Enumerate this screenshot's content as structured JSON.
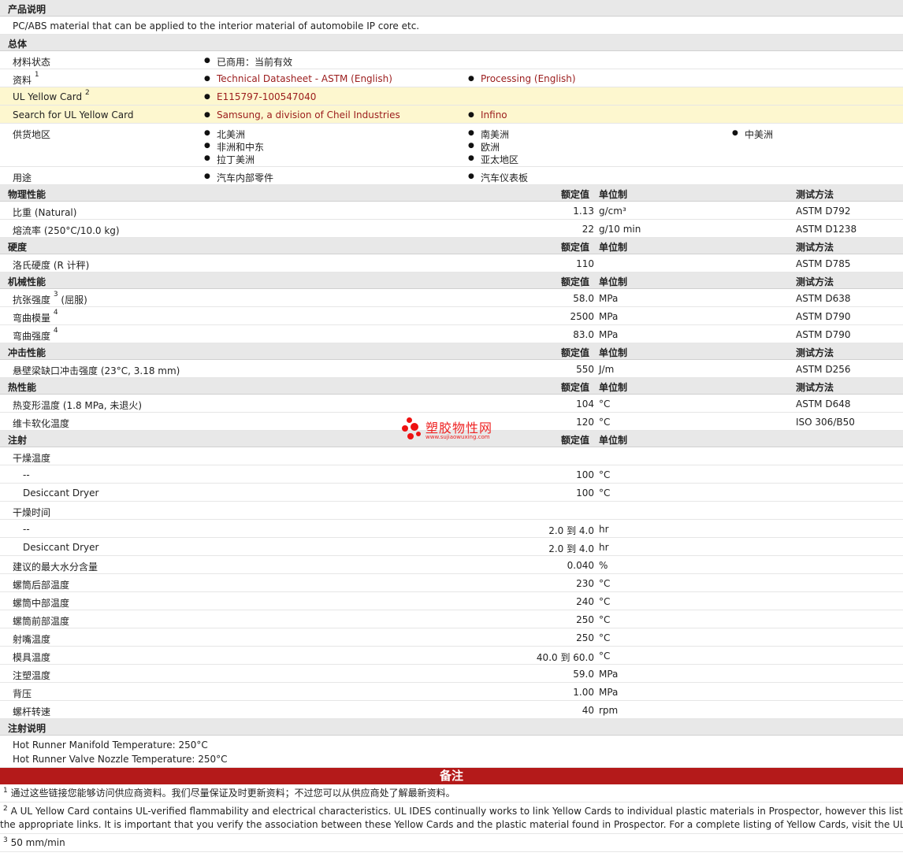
{
  "product": {
    "section": "产品说明",
    "description": "PC/ABS material that can be applied to the interior material of automobile IP core etc."
  },
  "general": {
    "section": "总体",
    "status_label": "材料状态",
    "status_value": "已商用：当前有效",
    "docs_label": "资料",
    "docs_sup": "1",
    "docs": [
      "Technical Datasheet - ASTM (English)",
      "Processing (English)"
    ],
    "ul_label": "UL Yellow Card",
    "ul_sup": "2",
    "ul_value": "E115797-100547040",
    "search_label": "Search for UL Yellow Card",
    "search_values": [
      "Samsung, a division of Cheil Industries",
      "Infino"
    ],
    "supply_label": "供货地区",
    "supply": [
      "北美洲",
      "南美洲",
      "中美洲",
      "非洲和中东",
      "欧洲",
      "拉丁美洲",
      "亚太地区"
    ],
    "use_label": "用途",
    "uses": [
      "汽车内部零件",
      "汽车仪表板"
    ]
  },
  "headers": {
    "value": "额定值",
    "unit": "单位制",
    "method": "测试方法"
  },
  "physical": {
    "section": "物理性能",
    "rows": [
      {
        "label": "比重 (Natural)",
        "sup": "",
        "value": "1.13",
        "unit": "g/cm³",
        "method": "ASTM D792"
      },
      {
        "label": "熔流率 (250°C/10.0 kg)",
        "sup": "",
        "value": "22",
        "unit": "g/10 min",
        "method": "ASTM D1238"
      }
    ]
  },
  "hardness": {
    "section": "硬度",
    "rows": [
      {
        "label": "洛氏硬度 (R 计秤)",
        "sup": "",
        "value": "110",
        "unit": "",
        "method": "ASTM D785"
      }
    ]
  },
  "mechanical": {
    "section": "机械性能",
    "rows": [
      {
        "label": "抗张强度",
        "sup": "3",
        "suffix": "(屈服)",
        "value": "58.0",
        "unit": "MPa",
        "method": "ASTM D638"
      },
      {
        "label": "弯曲模量",
        "sup": "4",
        "suffix": "",
        "value": "2500",
        "unit": "MPa",
        "method": "ASTM D790"
      },
      {
        "label": "弯曲强度",
        "sup": "4",
        "suffix": "",
        "value": "83.0",
        "unit": "MPa",
        "method": "ASTM D790"
      }
    ]
  },
  "impact": {
    "section": "冲击性能",
    "rows": [
      {
        "label": "悬壁梁缺口冲击强度 (23°C, 3.18 mm)",
        "sup": "",
        "value": "550",
        "unit": "J/m",
        "method": "ASTM D256"
      }
    ]
  },
  "thermal": {
    "section": "热性能",
    "rows": [
      {
        "label": "热变形温度 (1.8 MPa, 未退火)",
        "sup": "",
        "value": "104",
        "unit": "°C",
        "method": "ASTM D648"
      },
      {
        "label": "维卡软化温度",
        "sup": "",
        "value": "120",
        "unit": "°C",
        "method": "ISO 306/B50"
      }
    ]
  },
  "injection": {
    "section": "注射",
    "drying_temp_label": "干燥温度",
    "drying_temp": [
      {
        "label": "--",
        "value": "100",
        "unit": "°C"
      },
      {
        "label": "Desiccant Dryer",
        "value": "100",
        "unit": "°C"
      }
    ],
    "drying_time_label": "干燥时间",
    "drying_time": [
      {
        "label": "--",
        "value": "2.0 到  4.0",
        "unit": "hr"
      },
      {
        "label": "Desiccant Dryer",
        "value": "2.0 到  4.0",
        "unit": "hr"
      }
    ],
    "rows": [
      {
        "label": "建议的最大水分含量",
        "value": "0.040",
        "unit": "%"
      },
      {
        "label": "螺筒后部温度",
        "value": "230",
        "unit": "°C"
      },
      {
        "label": "螺筒中部温度",
        "value": "240",
        "unit": "°C"
      },
      {
        "label": "螺筒前部温度",
        "value": "250",
        "unit": "°C"
      },
      {
        "label": "射嘴温度",
        "value": "250",
        "unit": "°C"
      },
      {
        "label": "模具温度",
        "value": "40.0 到  60.0",
        "unit": "°C"
      },
      {
        "label": "注塑温度",
        "value": "59.0",
        "unit": "MPa"
      },
      {
        "label": "背压",
        "value": "1.00",
        "unit": "MPa"
      },
      {
        "label": "螺杆转速",
        "value": "40",
        "unit": "rpm"
      }
    ]
  },
  "injection_notes": {
    "section": "注射说明",
    "lines": [
      "Hot Runner Manifold Temperature: 250°C",
      "Hot Runner Valve Nozzle Temperature: 250°C"
    ]
  },
  "remarks": {
    "title": "备注",
    "notes": [
      {
        "num": "1",
        "lines": [
          "通过这些链接您能够访问供应商资料。我们尽量保证及时更新资料；不过您可以从供应商处了解最新资料。"
        ]
      },
      {
        "num": "2",
        "lines": [
          "A UL Yellow Card contains UL-verified flammability and electrical characteristics. UL IDES continually works to link Yellow Cards to individual plastic materials in Prospector, however this list may",
          "the appropriate links. It is important that you verify the association between these Yellow Cards and the plastic material found in Prospector. For a complete listing of Yellow Cards, visit the UL Yellow"
        ]
      },
      {
        "num": "3",
        "lines": [
          "50 mm/min"
        ]
      }
    ]
  },
  "watermark": {
    "text": "塑胶物性网",
    "url": "www.sujiaowuxing.com"
  },
  "colors": {
    "link": "#9b1c1c",
    "highlight": "#fdf7cf",
    "banner": "#b41a1a",
    "section": "#e8e8e8"
  }
}
